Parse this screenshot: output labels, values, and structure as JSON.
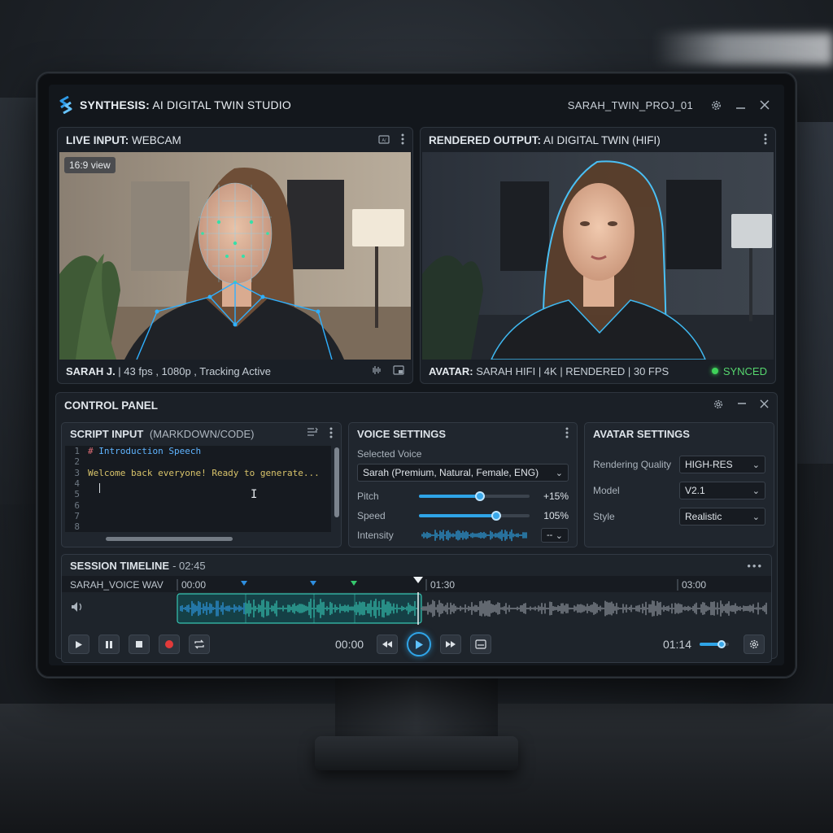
{
  "app": {
    "title_bold": "SYNTHESIS:",
    "title_rest": " AI DIGITAL TWIN STUDIO",
    "project": "SARAH_TWIN_PROJ_01"
  },
  "live_input": {
    "title_bold": "LIVE INPUT:",
    "title_rest": " WEBCAM",
    "view_badge": "16:9 view",
    "footer_bold": "SARAH J.",
    "footer_rest": " | 43 fps , 1080p , Tracking Active"
  },
  "rendered_output": {
    "title_bold": "RENDERED OUTPUT:",
    "title_rest": " AI DIGITAL TWIN (HIFI)",
    "footer_bold": "AVATAR:",
    "footer_rest": " SARAH HIFI | 4K | RENDERED | 30 FPS",
    "status": "SYNCED"
  },
  "control_panel": {
    "title": "CONTROL PANEL",
    "script": {
      "title_bold": "SCRIPT INPUT",
      "title_rest": "(MARKDOWN/CODE)",
      "line_numbers": [
        "1",
        "2",
        "3",
        "4",
        "5",
        "6",
        "7",
        "8"
      ],
      "lines": {
        "l1_hash": "# ",
        "l1_heading": "Introduction Speech",
        "l3": "Welcome back everyone! Ready to generate..."
      }
    },
    "voice": {
      "title": "VOICE SETTINGS",
      "selected_voice_label": "Selected Voice",
      "selected_voice": "Sarah (Premium, Natural, Female, ENG)",
      "pitch_label": "Pitch",
      "pitch_value": "+15%",
      "pitch_level": 0.55,
      "speed_label": "Speed",
      "speed_value": "105%",
      "speed_level": 0.7,
      "intensity_label": "Intensity",
      "intensity_value": "--"
    },
    "avatar": {
      "title": "AVATAR SETTINGS",
      "quality_label": "Rendering Quality",
      "quality_value": "HIGH-RES",
      "model_label": "Model",
      "model_value": "V2.1",
      "style_label": "Style",
      "style_value": "Realistic"
    },
    "timeline": {
      "title": "SESSION TIMELINE",
      "duration": " - 02:45",
      "track_name": "SARAH_VOICE WAV",
      "ticks": [
        "00:00",
        "01:30",
        "03:00"
      ],
      "current_time_left": "00:00",
      "current_time_right": "01:14",
      "volume_level": 0.75
    }
  },
  "colors": {
    "accent": "#2fa4e7",
    "synced": "#3fd25a",
    "record": "#e23a3a",
    "waveform_active": "#36c3b0",
    "waveform_rest": "#8f969e"
  }
}
